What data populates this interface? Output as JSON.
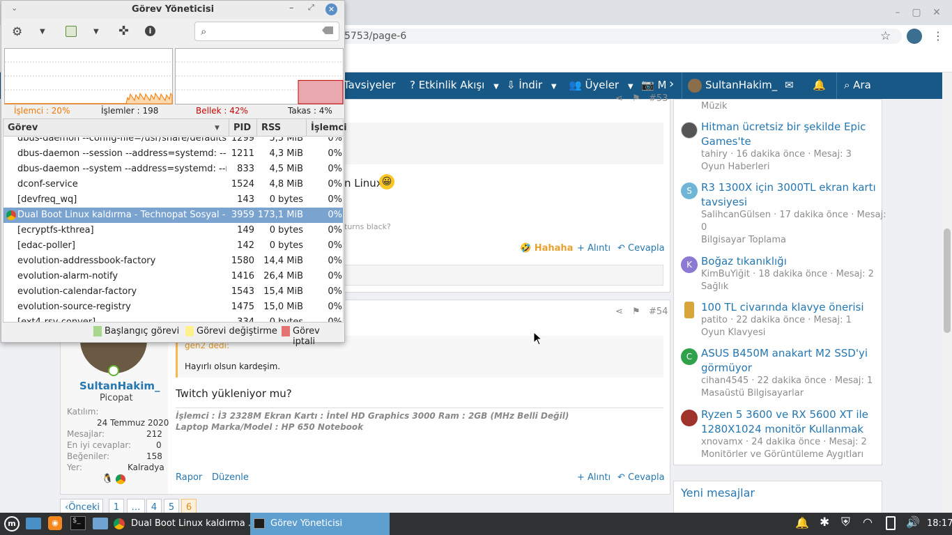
{
  "browser": {
    "url": "5753/page-6",
    "window_controls": [
      "–",
      "▢",
      "✕"
    ]
  },
  "nav": {
    "items": [
      "Tavsiyeler",
      "Etkinlik Akışı",
      "İndir",
      "Üyeler",
      "M"
    ],
    "user": "SultanHakim_",
    "search": "Ara"
  },
  "post53": {
    "number": "#53",
    "partial_text": "n Linux",
    "quote_text": "turns black?",
    "reaction": "Hahaha",
    "quote_btn": "Alıntı",
    "reply_btn": "Cevapla"
  },
  "post54": {
    "number": "#54",
    "quote_author": "gen2 dedi:",
    "quote_body": "Hayırlı olsun kardeşim.",
    "body": "Twitch yükleniyor mu?",
    "signature_line1": "İşlemci : İ3 2328M Ekran Kartı : İntel HD Graphics 3000 Ram : 2GB (MHz Belli Değil)",
    "signature_line2": "Laptop Marka/Model : HP 650 Notebook",
    "report": "Rapor",
    "edit": "Düzenle",
    "quote_btn": "Alıntı",
    "reply_btn": "Cevapla"
  },
  "author": {
    "name": "SultanHakim_",
    "title": "Picopat",
    "stats": [
      {
        "label": "Katılım:",
        "value": "24 Temmuz 2020"
      },
      {
        "label": "Mesajlar:",
        "value": "212"
      },
      {
        "label": "En iyi cevaplar:",
        "value": "0"
      },
      {
        "label": "Beğeniler:",
        "value": "158"
      },
      {
        "label": "Yer:",
        "value": "Kalradya"
      }
    ]
  },
  "pagination": {
    "prev": "Önceki",
    "pages": [
      "1",
      "…",
      "4",
      "5",
      "6"
    ]
  },
  "sidebar": {
    "top_forum": "Müzik",
    "threads": [
      {
        "title1": "Hitman ücretsiz bir şekilde Epic",
        "title2": "Games'te",
        "meta": "tahiry · 16 dakika önce · Mesaj: 3",
        "forum": "Oyun Haberleri",
        "avatar": ""
      },
      {
        "title1": "R3 1300X için 3000TL ekran kartı",
        "title2": "tavsiyesi",
        "meta": "SalihcanGülsen · 17 dakika önce · Mesaj:",
        "meta2": "0",
        "forum": "Bilgisayar Toplama",
        "avatar": "S"
      },
      {
        "title1": "Boğaz tıkanıklığı",
        "title2": "",
        "meta": "KimBuYiğit · 18 dakika önce · Mesaj: 2",
        "forum": "Sağlık",
        "avatar": "K"
      },
      {
        "title1": "100 TL civarında klavye önerisi",
        "title2": "",
        "meta": "patito · 22 dakika önce · Mesaj: 1",
        "forum": "Oyun Klavyesi",
        "avatar": ""
      },
      {
        "title1": "ASUS B450M anakart M2 SSD'yi",
        "title2": "görmüyor",
        "meta": "cihan4545 · 22 dakika önce · Mesaj: 1",
        "forum": "Masaüstü Bilgisayarlar",
        "avatar": "C"
      },
      {
        "title1": "Ryzen 5 3600 ve RX 5600 XT ile",
        "title2": "1280X1024 monitör Kullanmak",
        "meta": "xnovamx · 24 dakika önce · Mesaj: 2",
        "forum": "Monitörler ve Görüntüleme Aygıtları",
        "avatar": ""
      }
    ],
    "new_posts_title": "Yeni mesajlar"
  },
  "taskmanager": {
    "title": "Görev Yöneticisi",
    "cpu_label": "İşlemci : 20%",
    "processes_label": "İşlemler : 198",
    "mem_label": "Bellek : 42%",
    "swap_label": "Takas : 4%",
    "cpu_percent": 20,
    "mem_percent": 42,
    "columns": [
      "Görev",
      "PID",
      "RSS",
      "İşlemci"
    ],
    "rows": [
      {
        "name": "dbus-daemon --config-file=/usr/share/defaults/...",
        "pid": "1299",
        "rss": "5,5 MiB",
        "cpu": "0%"
      },
      {
        "name": "dbus-daemon --session --address=systemd: --no...",
        "pid": "1211",
        "rss": "4,3 MiB",
        "cpu": "0%"
      },
      {
        "name": "dbus-daemon --system --address=systemd: --no...",
        "pid": "833",
        "rss": "4,5 MiB",
        "cpu": "0%"
      },
      {
        "name": "dconf-service",
        "pid": "1524",
        "rss": "4,8 MiB",
        "cpu": "0%"
      },
      {
        "name": "[devfreq_wq]",
        "pid": "143",
        "rss": "0 bytes",
        "cpu": "0%"
      },
      {
        "name": "Dual Boot Linux kaldırma - Technopat Sosyal - ...",
        "pid": "3959",
        "rss": "173,1 MiB",
        "cpu": "0%"
      },
      {
        "name": "[ecryptfs-kthrea]",
        "pid": "149",
        "rss": "0 bytes",
        "cpu": "0%"
      },
      {
        "name": "[edac-poller]",
        "pid": "142",
        "rss": "0 bytes",
        "cpu": "0%"
      },
      {
        "name": "evolution-addressbook-factory",
        "pid": "1580",
        "rss": "14,4 MiB",
        "cpu": "0%"
      },
      {
        "name": "evolution-alarm-notify",
        "pid": "1416",
        "rss": "26,4 MiB",
        "cpu": "0%"
      },
      {
        "name": "evolution-calendar-factory",
        "pid": "1543",
        "rss": "15,4 MiB",
        "cpu": "0%"
      },
      {
        "name": "evolution-source-registry",
        "pid": "1475",
        "rss": "15,0 MiB",
        "cpu": "0%"
      },
      {
        "name": "[ext4-rsv-conver]",
        "pid": "334",
        "rss": "0 bytes",
        "cpu": "0%"
      }
    ],
    "selected_row": 5,
    "legend": [
      "Başlangıç görevi",
      "Görevi değiştirme",
      "Görev iptali"
    ]
  },
  "taskbar": {
    "items": [
      "Dual Boot Linux kaldırma ...",
      "Görev Yöneticisi"
    ],
    "clock": "18:17"
  },
  "colors": {
    "navbar": "#185886",
    "link": "#2577b1",
    "cpu": "#f57900",
    "mem": "#cc0000",
    "selected": "#7ba3cf",
    "taskbar": "#2f3133"
  }
}
